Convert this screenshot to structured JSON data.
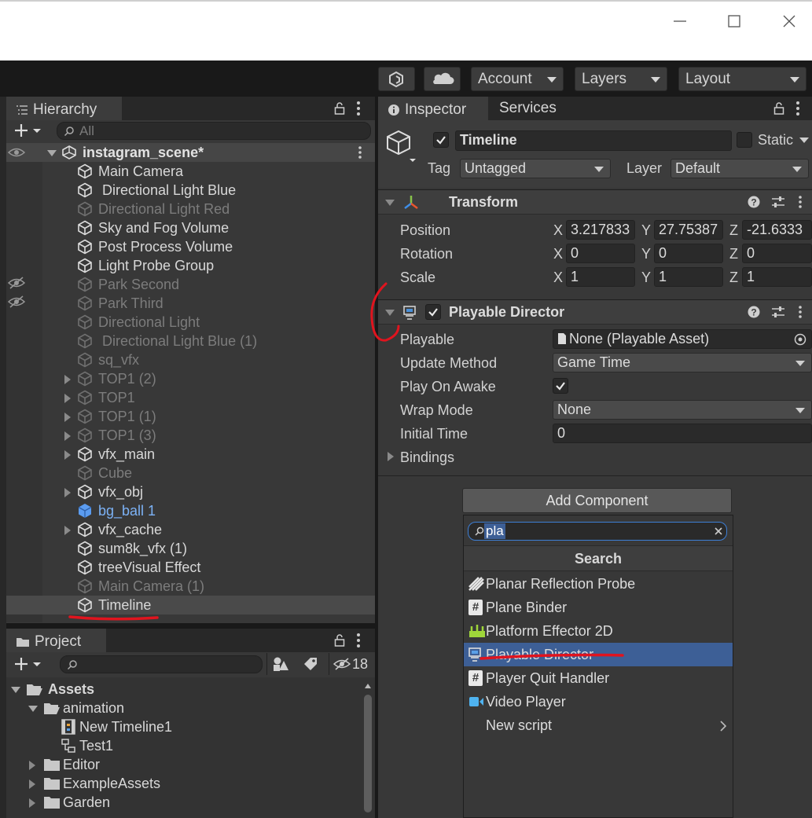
{
  "toolbar": {
    "account_label": "Account",
    "layers_label": "Layers",
    "layout_label": "Layout"
  },
  "hierarchy": {
    "tab_label": "Hierarchy",
    "search_placeholder": "All",
    "scene_name": "instagram_scene*",
    "items": [
      {
        "label": "Main Camera",
        "state": "normal"
      },
      {
        "label": " Directional Light Blue",
        "state": "normal"
      },
      {
        "label": "Directional Light Red",
        "state": "dim"
      },
      {
        "label": "Sky and Fog Volume",
        "state": "normal"
      },
      {
        "label": "Post Process Volume",
        "state": "normal"
      },
      {
        "label": "Light Probe Group",
        "state": "normal"
      },
      {
        "label": "Park Second",
        "state": "dim"
      },
      {
        "label": "Park Third",
        "state": "dim"
      },
      {
        "label": "Directional Light",
        "state": "dim"
      },
      {
        "label": " Directional Light Blue (1)",
        "state": "dim"
      },
      {
        "label": "sq_vfx",
        "state": "dim"
      },
      {
        "label": "TOP1 (2)",
        "state": "dim"
      },
      {
        "label": "TOP1",
        "state": "dim"
      },
      {
        "label": "TOP1 (1)",
        "state": "dim"
      },
      {
        "label": "TOP1 (3)",
        "state": "dim"
      },
      {
        "label": "vfx_main",
        "state": "normal"
      },
      {
        "label": "Cube",
        "state": "dim"
      },
      {
        "label": "vfx_obj",
        "state": "normal"
      },
      {
        "label": "bg_ball 1",
        "state": "prefab"
      },
      {
        "label": "vfx_cache",
        "state": "normal"
      },
      {
        "label": "sum8k_vfx (1)",
        "state": "normal"
      },
      {
        "label": "treeVisual Effect",
        "state": "normal"
      },
      {
        "label": "Main Camera (1)",
        "state": "dim"
      },
      {
        "label": "Timeline",
        "state": "selected"
      }
    ]
  },
  "project": {
    "tab_label": "Project",
    "hidden_count": "18",
    "tree": [
      {
        "label": "Assets"
      },
      {
        "label": "animation"
      },
      {
        "label": "New Timeline1"
      },
      {
        "label": "Test1"
      },
      {
        "label": "Editor"
      },
      {
        "label": "ExampleAssets"
      },
      {
        "label": "Garden"
      }
    ]
  },
  "inspector": {
    "tab_label": "Inspector",
    "services_tab_label": "Services",
    "object_name": "Timeline",
    "static_label": "Static",
    "tag_label": "Tag",
    "tag_value": "Untagged",
    "layer_label": "Layer",
    "layer_value": "Default",
    "transform": {
      "title": "Transform",
      "position_label": "Position",
      "rotation_label": "Rotation",
      "scale_label": "Scale",
      "axis_x": "X",
      "axis_y": "Y",
      "axis_z": "Z",
      "position": [
        "3.217833",
        "27.75387",
        "-21.6333"
      ],
      "rotation": [
        "0",
        "0",
        "0"
      ],
      "scale": [
        "1",
        "1",
        "1"
      ]
    },
    "playable_director": {
      "title": "Playable Director",
      "playable_label": "Playable",
      "playable_value": "None (Playable Asset)",
      "update_method_label": "Update Method",
      "update_method_value": "Game Time",
      "play_on_awake_label": "Play On Awake",
      "wrap_mode_label": "Wrap Mode",
      "wrap_mode_value": "None",
      "initial_time_label": "Initial Time",
      "initial_time_value": "0",
      "bindings_label": "Bindings"
    },
    "add_component_label": "Add Component"
  },
  "add_component_popup": {
    "search_value": "pla",
    "header": "Search",
    "items": [
      {
        "label": "Planar Reflection Probe",
        "icon": "reflection-probe-icon"
      },
      {
        "label": "Plane Binder",
        "icon": "script-icon"
      },
      {
        "label": "Platform Effector 2D",
        "icon": "effector-icon"
      },
      {
        "label": "Playable Director",
        "icon": "playable-director-icon"
      },
      {
        "label": "Player Quit Handler",
        "icon": "script-icon"
      },
      {
        "label": "Video Player",
        "icon": "video-player-icon"
      },
      {
        "label": "New script",
        "icon": ""
      }
    ]
  },
  "colors": {
    "selection": "#3d5f96",
    "prefab_text": "#7cb2f6",
    "annotation_red": "#e0141e"
  }
}
